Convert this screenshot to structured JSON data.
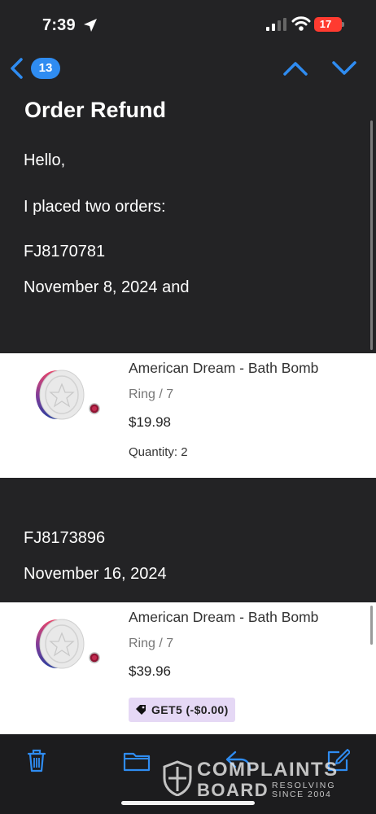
{
  "status_bar": {
    "time": "7:39",
    "battery": "17"
  },
  "nav": {
    "unread_count": "13"
  },
  "email": {
    "subject": "Order Refund",
    "greeting": "Hello,",
    "intro": "I placed two orders:",
    "order1_id": "FJ8170781",
    "order1_date": "November 8, 2024 and",
    "order2_id": "FJ8173896",
    "order2_date": "November 16, 2024"
  },
  "products": [
    {
      "name": "American Dream - Bath Bomb",
      "variant": "Ring / 7",
      "price": "$19.98",
      "quantity": "Quantity: 2"
    },
    {
      "name": "American Dream - Bath Bomb",
      "variant": "Ring / 7",
      "price": "$39.96",
      "discount": "GET5 (-$0.00)"
    }
  ],
  "toolbar": {
    "icons": [
      "trash-icon",
      "folder-icon",
      "reply-icon",
      "compose-icon"
    ]
  },
  "watermark": {
    "line1": "COMPLAINTS",
    "line2": "BOARD",
    "tag1": "RESOLVING",
    "tag2": "SINCE 2004"
  },
  "colors": {
    "accent": "#2f8cf1",
    "battery": "#ff3b30",
    "discount_bg": "#e5d8f5",
    "background": "#232325"
  }
}
